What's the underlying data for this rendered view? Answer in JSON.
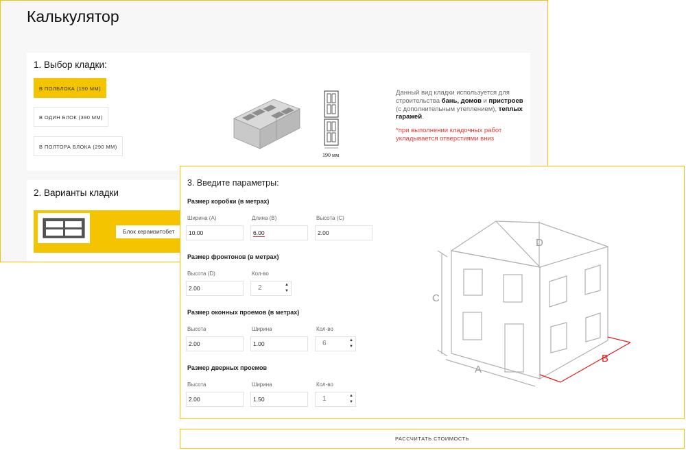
{
  "window1": {
    "title": "Калькулятор",
    "section1": {
      "heading": "1. Выбор кладки:",
      "options": [
        "В ПОЛБЛОКА (190 ММ)",
        "В ОДИН БЛОК (390 ММ)",
        "В ПОЛТОРА БЛОКА (290 ММ)"
      ],
      "selected_index": 0,
      "dimension_label": "190 мм",
      "desc_parts": [
        "Данный вид кладки используется для строительства ",
        "бань, домов",
        " и ",
        "пристроев",
        " (с дополнительным утеплением), ",
        "теплых гаражей",
        "."
      ],
      "note": "*при выполнении кладочных работ укладывается отверстиями вниз"
    },
    "section2": {
      "heading": "2. Варианты кладки",
      "block_button": "Блок керамзитобет"
    }
  },
  "window3": {
    "heading": "3. Введите параметры:",
    "box": {
      "title": "Размер коробки (в метрах)",
      "width_label": "Ширина (A)",
      "width_value": "10.00",
      "length_label": "Длина (B)",
      "length_value": "6.00",
      "height_label": "Высота (C)",
      "height_value": "2.00"
    },
    "gables": {
      "title": "Размер фронтонов (в метрах)",
      "height_label": "Высота (D)",
      "height_value": "2.00",
      "count_label": "Кол-во",
      "count_value": "2"
    },
    "windows": {
      "title": "Размер оконных проемов (в метрах)",
      "height_label": "Высота",
      "height_value": "2.00",
      "width_label": "Ширина",
      "width_value": "1.00",
      "count_label": "Кол-во",
      "count_value": "6"
    },
    "doors": {
      "title": "Размер дверных проемов",
      "height_label": "Высота",
      "height_value": "2.00",
      "width_label": "Ширина",
      "width_value": "1.50",
      "count_label": "Кол-во",
      "count_value": "1"
    },
    "diagram_labels": {
      "a": "A",
      "b": "B",
      "c": "C",
      "d": "D"
    }
  },
  "calculate_button": "РАССЧИТАТЬ СТОИМОСТЬ",
  "colors": {
    "accent": "#f5c400",
    "note_red": "#e53935",
    "b_dimension": "#e21b1b"
  }
}
